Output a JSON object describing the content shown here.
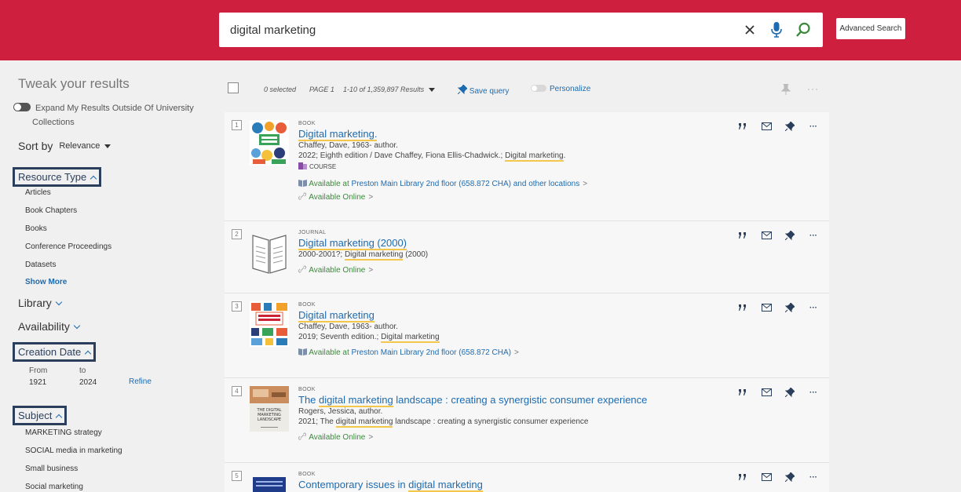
{
  "search": {
    "query": "digital marketing",
    "advanced_label": "Advanced Search"
  },
  "sidebar": {
    "tweak_title": "Tweak your results",
    "expand_label_line1": "Expand My Results Outside Of University",
    "expand_label_line2": "Collections",
    "sort_label": "Sort by",
    "sort_value": "Relevance",
    "resource_type": {
      "label": "Resource Type",
      "items": [
        "Articles",
        "Book Chapters",
        "Books",
        "Conference Proceedings",
        "Datasets"
      ],
      "show_more": "Show More"
    },
    "library_label": "Library",
    "availability_label": "Availability",
    "creation_date": {
      "label": "Creation Date",
      "from_label": "From",
      "to_label": "to",
      "from_value": "1921",
      "to_value": "2024",
      "refine_label": "Refine"
    },
    "subject": {
      "label": "Subject",
      "items": [
        "MARKETING strategy",
        "SOCIAL media in marketing",
        "Small business",
        "Social marketing"
      ]
    }
  },
  "toolbar": {
    "selected": "0 selected",
    "page": "PAGE 1",
    "results": "1-10 of 1,359,897 Results",
    "save_query": "Save query",
    "personalize": "Personalize"
  },
  "results": [
    {
      "num": "1",
      "type": "BOOK",
      "title": "Digital marketing.",
      "author": "Chaffey, Dave, 1963- author.",
      "detail_pre": "2022; Eighth edition / Dave Chaffey, Fiona Ellis-Chadwick.; ",
      "detail_hl": "Digital marketing",
      "detail_post": ".",
      "course": "COURSE",
      "avail_pre": "Available at ",
      "avail_loc": "Preston Main Library  2nd floor (658.872 CHA) and other locations",
      "online": "Available Online"
    },
    {
      "num": "2",
      "type": "JOURNAL",
      "title": "Digital marketing (2000)",
      "detail_pre": "2000-2001?; ",
      "detail_hl": "Digital marketing",
      "detail_post": " (2000)",
      "online": "Available Online"
    },
    {
      "num": "3",
      "type": "BOOK",
      "title": "Digital marketing",
      "author": "Chaffey, Dave, 1963- author.",
      "detail_pre": "2019; Seventh edition.; ",
      "detail_hl": "Digital marketing",
      "detail_post": "",
      "avail_pre": "Available at ",
      "avail_loc": "Preston Main Library  2nd floor (658.872 CHA)"
    },
    {
      "num": "4",
      "type": "BOOK",
      "title_pre": "The ",
      "title_hl": "digital marketing",
      "title_post": " landscape : creating a synergistic consumer experience",
      "author": "Rogers, Jessica, author.",
      "detail_pre": "2021; The ",
      "detail_hl": "digital marketing",
      "detail_post": " landscape : creating a synergistic consumer experience",
      "online": "Available Online",
      "cover_text": "THE DIGITAL MARKETING LANDSCAPE"
    },
    {
      "num": "5",
      "type": "BOOK",
      "title_pre": "Contemporary issues in ",
      "title_hl": "digital marketing",
      "title_post": ""
    }
  ],
  "actions": {
    "cite": "”",
    "more": "···"
  },
  "colors": {
    "brand": "#cf1f3f",
    "link": "#1d6bb0",
    "available": "#3a8a3a",
    "highlight": "#f3c74b",
    "facet_border": "#2b3f5c"
  },
  "icons": [
    "close-icon",
    "microphone-icon",
    "search-icon",
    "pin-icon",
    "mail-icon",
    "quote-icon",
    "more-icon",
    "book-icon",
    "link-icon",
    "course-icon"
  ]
}
